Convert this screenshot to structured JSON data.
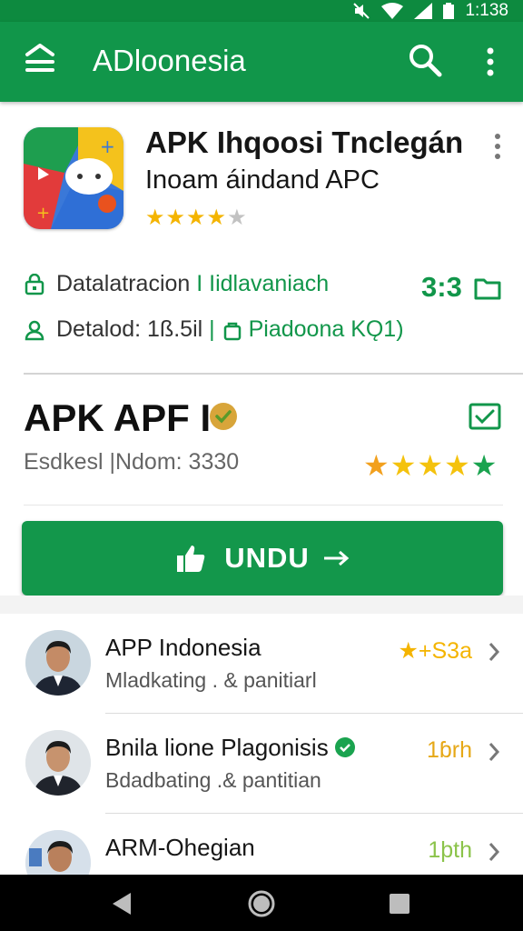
{
  "status_bar": {
    "time": "1:138"
  },
  "appbar": {
    "title": "ADloonesia"
  },
  "app": {
    "title": "APK Ihqoosi Tnclegán",
    "subtitle": "Inoam áindand APC",
    "rating_stars": 4,
    "rating_max": 5,
    "info_row1_label": "Datalatracion",
    "info_row1_sep": " I ",
    "info_row1_value": "Iidlavaniach",
    "info_row2_label": "Detalod: 1ß.5il",
    "info_row2_sep": " | ",
    "info_row2_value": "Piadoona KǪ1)",
    "count": "3:3"
  },
  "apk": {
    "title": "APK APF I",
    "subtitle": "Esdkesl |Ndom: 3330",
    "rating_stars": 5
  },
  "download_button": {
    "label": "UNDU"
  },
  "list": [
    {
      "title": "APP Indonesia",
      "subtitle": "Mladkating . & panitiarl",
      "meta": "★+S3a",
      "meta_color": "#f4b400",
      "verified": false
    },
    {
      "title": "Bnila lione Plagonisis",
      "subtitle": "Bdadbating .& pantitian",
      "meta": "1ɓrh",
      "meta_color": "#e6a817",
      "verified": true
    },
    {
      "title": "ARM-Ohegian",
      "subtitle": "",
      "meta": "1þth",
      "meta_color": "#8bc34a",
      "verified": false
    }
  ],
  "colors": {
    "primary": "#11964a",
    "star": "#f4b400"
  }
}
